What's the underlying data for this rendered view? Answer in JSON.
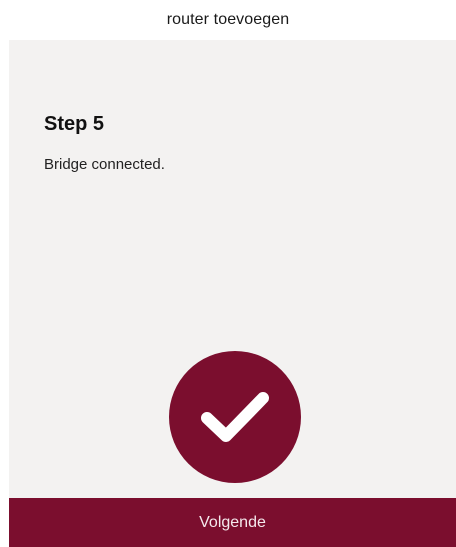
{
  "header": {
    "title": "router toevoegen"
  },
  "step": {
    "title": "Step 5",
    "description": "Bridge connected."
  },
  "status": {
    "icon": "checkmark-icon",
    "color": "#7b0e2e"
  },
  "footer": {
    "next_label": "Volgende"
  },
  "colors": {
    "accent": "#7b0e2e",
    "panel_background": "#f3f2f1",
    "page_background": "#ffffff"
  }
}
